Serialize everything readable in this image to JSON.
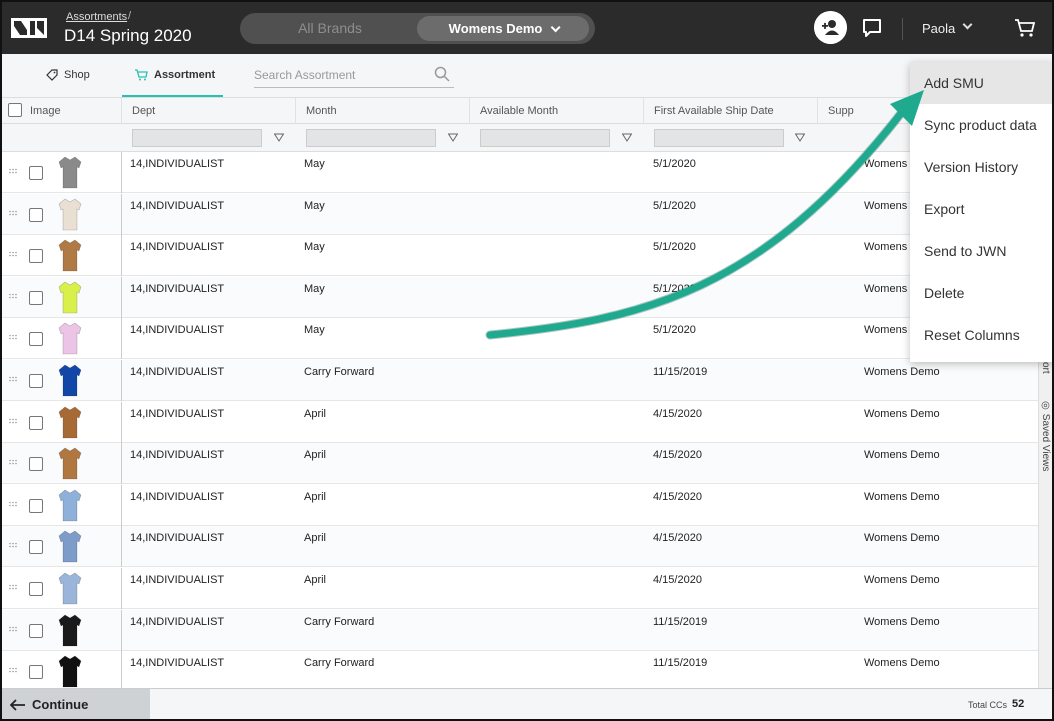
{
  "app": {
    "breadcrumb": "Assortments",
    "breadcrumb_sep": "/",
    "title": "D14 Spring 2020",
    "brand_all": "All Brands",
    "brand_selected": "Womens Demo",
    "user": "Paola"
  },
  "tabs": {
    "shop": "Shop",
    "assortment": "Assortment"
  },
  "search": {
    "placeholder": "Search Assortment"
  },
  "columns": [
    "Image",
    "Dept",
    "Month",
    "Available Month",
    "First Available Ship Date",
    "Supp"
  ],
  "rows": [
    {
      "dept": "14,INDIVIDUALIST",
      "month": "May",
      "ship": "5/1/2020",
      "supp": "Womens",
      "color": "#8a8a8a"
    },
    {
      "dept": "14,INDIVIDUALIST",
      "month": "May",
      "ship": "5/1/2020",
      "supp": "Womens",
      "color": "#eadfd3"
    },
    {
      "dept": "14,INDIVIDUALIST",
      "month": "May",
      "ship": "5/1/2020",
      "supp": "Womens",
      "color": "#b07a45"
    },
    {
      "dept": "14,INDIVIDUALIST",
      "month": "May",
      "ship": "5/1/2020",
      "supp": "Womens",
      "color": "#d9f04a"
    },
    {
      "dept": "14,INDIVIDUALIST",
      "month": "May",
      "ship": "5/1/2020",
      "supp": "Womens",
      "color": "#ecc4e6"
    },
    {
      "dept": "14,INDIVIDUALIST",
      "month": "Carry Forward",
      "ship": "11/15/2019",
      "supp": "Womens Demo",
      "color": "#1247a8"
    },
    {
      "dept": "14,INDIVIDUALIST",
      "month": "April",
      "ship": "4/15/2020",
      "supp": "Womens Demo",
      "color": "#a86a35"
    },
    {
      "dept": "14,INDIVIDUALIST",
      "month": "April",
      "ship": "4/15/2020",
      "supp": "Womens Demo",
      "color": "#b07840"
    },
    {
      "dept": "14,INDIVIDUALIST",
      "month": "April",
      "ship": "4/15/2020",
      "supp": "Womens Demo",
      "color": "#8fb0d8"
    },
    {
      "dept": "14,INDIVIDUALIST",
      "month": "April",
      "ship": "4/15/2020",
      "supp": "Womens Demo",
      "color": "#7d9cc9"
    },
    {
      "dept": "14,INDIVIDUALIST",
      "month": "April",
      "ship": "4/15/2020",
      "supp": "Womens Demo",
      "color": "#9ab5d9"
    },
    {
      "dept": "14,INDIVIDUALIST",
      "month": "Carry Forward",
      "ship": "11/15/2019",
      "supp": "Womens Demo",
      "color": "#1a1a1a"
    },
    {
      "dept": "14,INDIVIDUALIST",
      "month": "Carry Forward",
      "ship": "11/15/2019",
      "supp": "Womens Demo",
      "color": "#111111"
    }
  ],
  "menu": [
    "Add SMU",
    "Sync product data",
    "Version History",
    "Export",
    "Send to JWN",
    "Delete",
    "Reset Columns"
  ],
  "side": {
    "export": "ort",
    "saved_views": "Saved Views"
  },
  "footer": {
    "continue": "Continue Shopping",
    "total_label": "Total CCs",
    "total_value": "52"
  },
  "colors": {
    "accent": "#27c1b1",
    "annotation_arrow": "#1fa98e",
    "topbar": "#2b2b2b"
  }
}
